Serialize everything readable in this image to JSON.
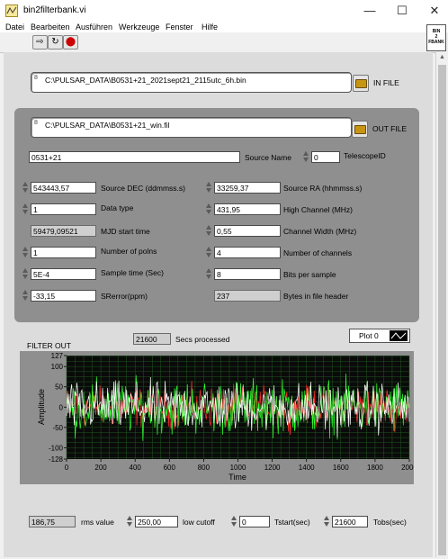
{
  "window": {
    "title": "bin2filterbank.vi"
  },
  "menu": [
    "Datei",
    "Bearbeiten",
    "Ausführen",
    "Werkzeuge",
    "Fenster",
    "Hilfe"
  ],
  "toolbar_icon": {
    "line1": "BIN",
    "line2": "2",
    "line3": "FBANK"
  },
  "infile": {
    "path": "C:\\PULSAR_DATA\\B0531+21_2021sept21_2115utc_6h.bin",
    "prefix": "8",
    "label": "IN FILE"
  },
  "outfile": {
    "path": "C:\\PULSAR_DATA\\B0531+21_win.fil",
    "prefix": "8",
    "label": "OUT FILE"
  },
  "source_name": {
    "value": "0531+21",
    "label": "Source Name"
  },
  "telescope": {
    "value": "0",
    "label": "TelescopeID"
  },
  "left_params": [
    {
      "value": "543443,57",
      "label": "Source DEC (ddmmss.s)",
      "kind": "control"
    },
    {
      "value": "1",
      "label": "Data type",
      "kind": "control"
    },
    {
      "value": "59479,09521",
      "label": "MJD start time",
      "kind": "indicator"
    },
    {
      "value": "1",
      "label": "Number of polns",
      "kind": "control"
    },
    {
      "value": "5E-4",
      "label": "Sample time (Sec)",
      "kind": "control"
    },
    {
      "value": "-33,15",
      "label": "SRerror(ppm)",
      "kind": "control"
    }
  ],
  "right_params": [
    {
      "value": "33259,37",
      "label": "Source RA (hhmmss.s)",
      "kind": "control"
    },
    {
      "value": "431,95",
      "label": "High Channel (MHz)",
      "kind": "control"
    },
    {
      "value": "0,55",
      "label": "Channel Width (MHz)",
      "kind": "control"
    },
    {
      "value": "4",
      "label": "Number of channels",
      "kind": "control"
    },
    {
      "value": "8",
      "label": "Bits per sample",
      "kind": "control"
    },
    {
      "value": "237",
      "label": "Bytes in file header",
      "kind": "indicator"
    }
  ],
  "secs_processed": {
    "value": "21600",
    "label": "Secs processed"
  },
  "plot_legend": {
    "label": "Plot 0"
  },
  "filter_out_label": "FILTER OUT",
  "chart_data": {
    "type": "line",
    "title": "",
    "xlabel": "Time",
    "ylabel": "Amplitude",
    "xlim": [
      0,
      2000
    ],
    "ylim": [
      -128,
      127
    ],
    "x_ticks": [
      "0",
      "200",
      "400",
      "600",
      "800",
      "1000",
      "1200",
      "1400",
      "1600",
      "1800",
      "2000"
    ],
    "y_ticks": [
      {
        "v": 127,
        "t": "127"
      },
      {
        "v": 100,
        "t": "100"
      },
      {
        "v": 50,
        "t": "50"
      },
      {
        "v": 0,
        "t": "0"
      },
      {
        "v": -50,
        "t": "-50"
      },
      {
        "v": -100,
        "t": "-100"
      },
      {
        "v": -128,
        "t": "-128"
      }
    ],
    "grid": true,
    "series": [
      {
        "color": "#ff3030",
        "amplitude": 45
      },
      {
        "color": "#30ff30",
        "amplitude": 60
      },
      {
        "color": "#ffffff",
        "amplitude": 55
      }
    ]
  },
  "bottom": [
    {
      "value": "186,75",
      "label": "rms value",
      "kind": "indicator"
    },
    {
      "value": "250,00",
      "label": "low cutoff",
      "kind": "control"
    },
    {
      "value": "0",
      "label": "Tstart(sec)",
      "kind": "control"
    },
    {
      "value": "21600",
      "label": "Tobs(sec)",
      "kind": "control"
    }
  ]
}
